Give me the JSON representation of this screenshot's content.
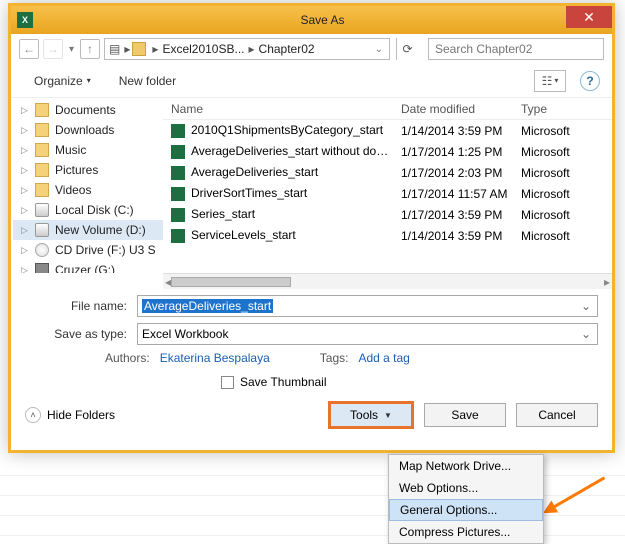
{
  "title": "Save As",
  "close_icon": "✕",
  "address": {
    "segments": [
      "Excel2010SB...",
      "Chapter02"
    ],
    "search_placeholder": "Search Chapter02"
  },
  "toolbar": {
    "organize": "Organize",
    "new_folder": "New folder"
  },
  "tree": [
    {
      "label": "Documents",
      "icon": "folder"
    },
    {
      "label": "Downloads",
      "icon": "folder"
    },
    {
      "label": "Music",
      "icon": "folder"
    },
    {
      "label": "Pictures",
      "icon": "folder"
    },
    {
      "label": "Videos",
      "icon": "folder"
    },
    {
      "label": "Local Disk (C:)",
      "icon": "disk"
    },
    {
      "label": "New Volume (D:)",
      "icon": "disk",
      "selected": true
    },
    {
      "label": "CD Drive (F:) U3 S",
      "icon": "cd"
    },
    {
      "label": "Cruzer (G:)",
      "icon": "usb"
    }
  ],
  "columns": {
    "name": "Name",
    "date": "Date modified",
    "type": "Type"
  },
  "files": [
    {
      "name": "2010Q1ShipmentsByCategory_start",
      "date": "1/14/2014 3:59 PM",
      "type": "Microsoft"
    },
    {
      "name": "AverageDeliveries_start without doc prop",
      "date": "1/17/2014 1:25 PM",
      "type": "Microsoft"
    },
    {
      "name": "AverageDeliveries_start",
      "date": "1/17/2014 2:03 PM",
      "type": "Microsoft"
    },
    {
      "name": "DriverSortTimes_start",
      "date": "1/17/2014 11:57 AM",
      "type": "Microsoft"
    },
    {
      "name": "Series_start",
      "date": "1/17/2014 3:59 PM",
      "type": "Microsoft"
    },
    {
      "name": "ServiceLevels_start",
      "date": "1/14/2014 3:59 PM",
      "type": "Microsoft"
    }
  ],
  "form": {
    "file_name_label": "File name:",
    "file_name_value": "AverageDeliveries_start",
    "save_type_label": "Save as type:",
    "save_type_value": "Excel Workbook",
    "authors_label": "Authors:",
    "authors_value": "Ekaterina Bespalaya",
    "tags_label": "Tags:",
    "tags_value": "Add a tag",
    "save_thumbnail": "Save Thumbnail"
  },
  "footer": {
    "hide_folders": "Hide Folders",
    "tools": "Tools",
    "save": "Save",
    "cancel": "Cancel"
  },
  "tools_menu": [
    "Map Network Drive...",
    "Web Options...",
    "General Options...",
    "Compress Pictures..."
  ],
  "accent_orange": "#e8742c"
}
